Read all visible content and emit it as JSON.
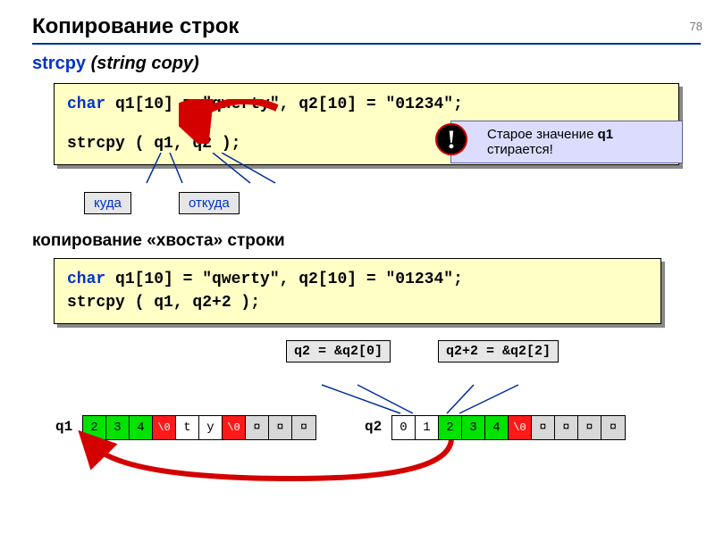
{
  "page_number": "78",
  "title": "Копирование строк",
  "subtitle_fn": "strcpy",
  "subtitle_desc": "(string copy)",
  "code1_line1_a": "char",
  "code1_line1_b": " q1[10] = \"qwerty\",  q2[10] = \"01234\";",
  "code1_line2": "strcpy ( q1, q2 );",
  "label_kuda": "куда",
  "label_otkuda": "откуда",
  "warn_text_a": "Старое значение ",
  "warn_text_b": "q1",
  "warn_text_c": " стирается!",
  "bang": "!",
  "sub2": "копирование «хвоста» строки",
  "code2_line1_a": "char",
  "code2_line1_b": " q1[10] = \"qwerty\", q2[10] = \"01234\";",
  "code2_line2": "strcpy ( q1, q2+2 );",
  "expr1": "q2 = &q2[0]",
  "expr2": "q2+2 = &q2[2]",
  "q1label": "q1",
  "q2label": "q2",
  "q1cells": [
    "2",
    "3",
    "4",
    "\\0",
    "t",
    "y",
    "\\0",
    "¤",
    "¤",
    "¤"
  ],
  "q2cells": [
    "0",
    "1",
    "2",
    "3",
    "4",
    "\\0",
    "¤",
    "¤",
    "¤",
    "¤"
  ],
  "q1colors": [
    "g",
    "g",
    "g",
    "r",
    "w",
    "w",
    "r",
    "gr",
    "gr",
    "gr"
  ],
  "q2colors": [
    "w",
    "w",
    "g",
    "g",
    "g",
    "r",
    "gr",
    "gr",
    "gr",
    "gr"
  ]
}
